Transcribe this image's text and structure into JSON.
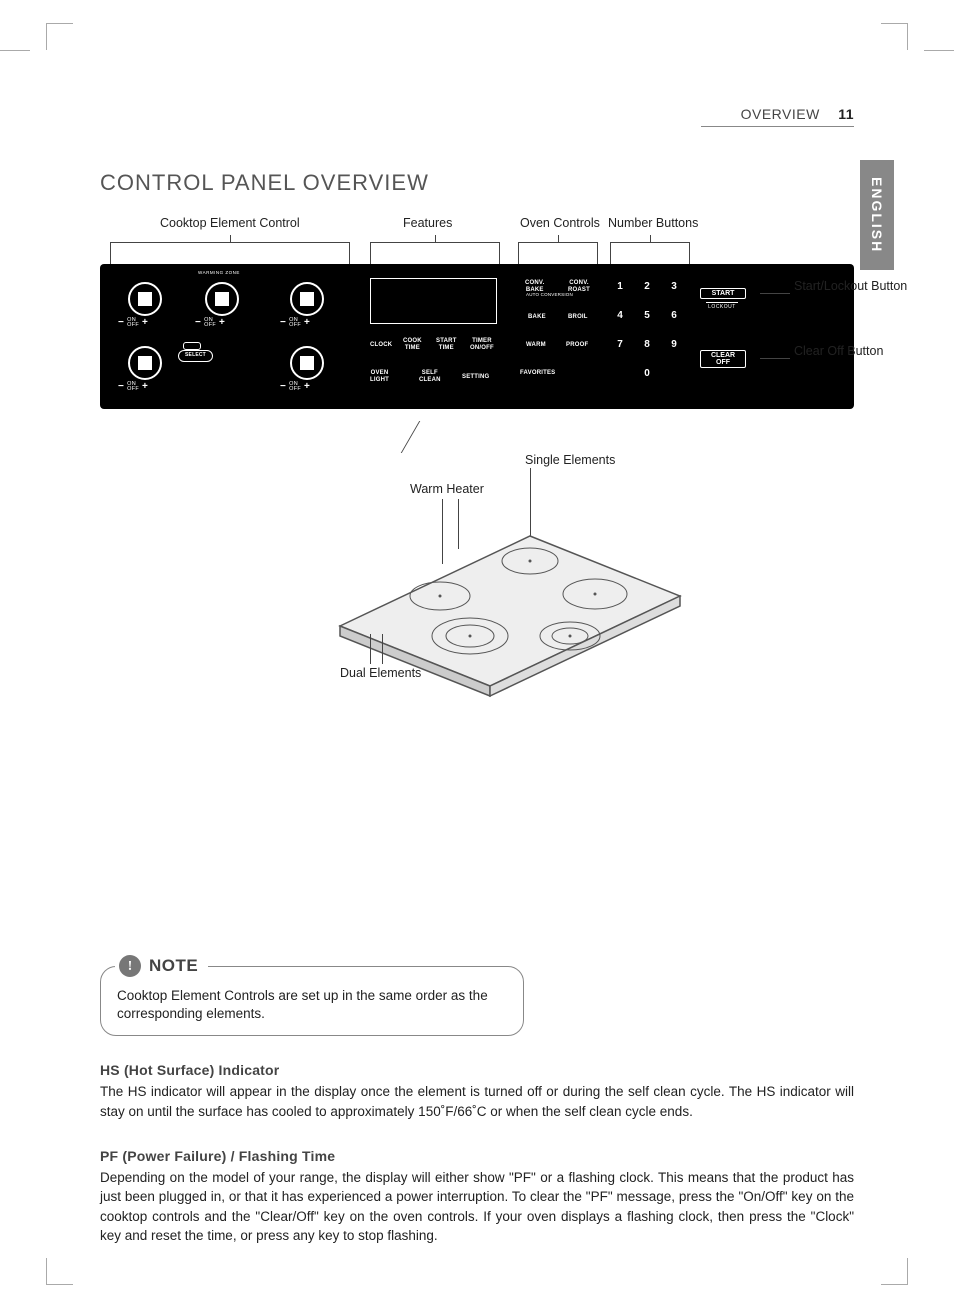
{
  "header": {
    "section": "OVERVIEW",
    "page": "11"
  },
  "sidetab": "ENGLISH",
  "title": "CONTROL PANEL OVERVIEW",
  "diagram": {
    "topLabels": {
      "cooktop": "Cooktop Element Control",
      "features": "Features",
      "oven": "Oven Controls",
      "numbers": "Number Buttons"
    },
    "rightLabels": {
      "start": "Start/Lockout Button",
      "clear": "Clear Off Button"
    },
    "panel": {
      "warmingZone": "WARMING ZONE",
      "select": "SELECT",
      "onoff": "ON\nOFF",
      "featuresRow1": [
        "CLOCK",
        "COOK\nTIME",
        "START\nTIME",
        "TIMER\nON/OFF"
      ],
      "featuresRow2": [
        "OVEN\nLIGHT",
        "SELF\nCLEAN",
        "SETTING"
      ],
      "ovenCtrls": [
        "CONV.\nBAKE",
        "CONV.\nROAST",
        "BAKE",
        "BROIL",
        "WARM",
        "PROOF",
        "FAVORITES"
      ],
      "autoConv": "AUTO CONVERSION",
      "numbers": [
        "1",
        "2",
        "3",
        "4",
        "5",
        "6",
        "7",
        "8",
        "9",
        "0"
      ],
      "startBtn": "START",
      "lockout": "LOCKOUT",
      "clearBtn": "CLEAR\nOFF"
    },
    "cooktopLabels": {
      "single": "Single Elements",
      "warm": "Warm Heater",
      "dual": "Dual Elements"
    }
  },
  "note": {
    "title": "NOTE",
    "text": "Cooktop Element Controls are set up in the same order as the corresponding elements."
  },
  "sections": [
    {
      "heading": "HS (Hot Surface) Indicator",
      "body": "The HS indicator will appear in the display once the element is turned off or during the self clean cycle. The HS indicator will stay on until the surface has cooled to approximately 150˚F/66˚C or when the self clean cycle ends."
    },
    {
      "heading": "PF (Power Failure) / Flashing Time",
      "body": "Depending on the model of your range, the display will either show \"PF\" or a flashing clock.  This means that the product has just been plugged in, or that it has experienced a power interruption.  To clear the \"PF\" message, press the \"On/Off\" key on the cooktop controls and the \"Clear/Off\" key on the oven controls.  If your oven displays a flashing clock, then press the \"Clock\" key and reset the time, or press any key to stop flashing."
    }
  ]
}
